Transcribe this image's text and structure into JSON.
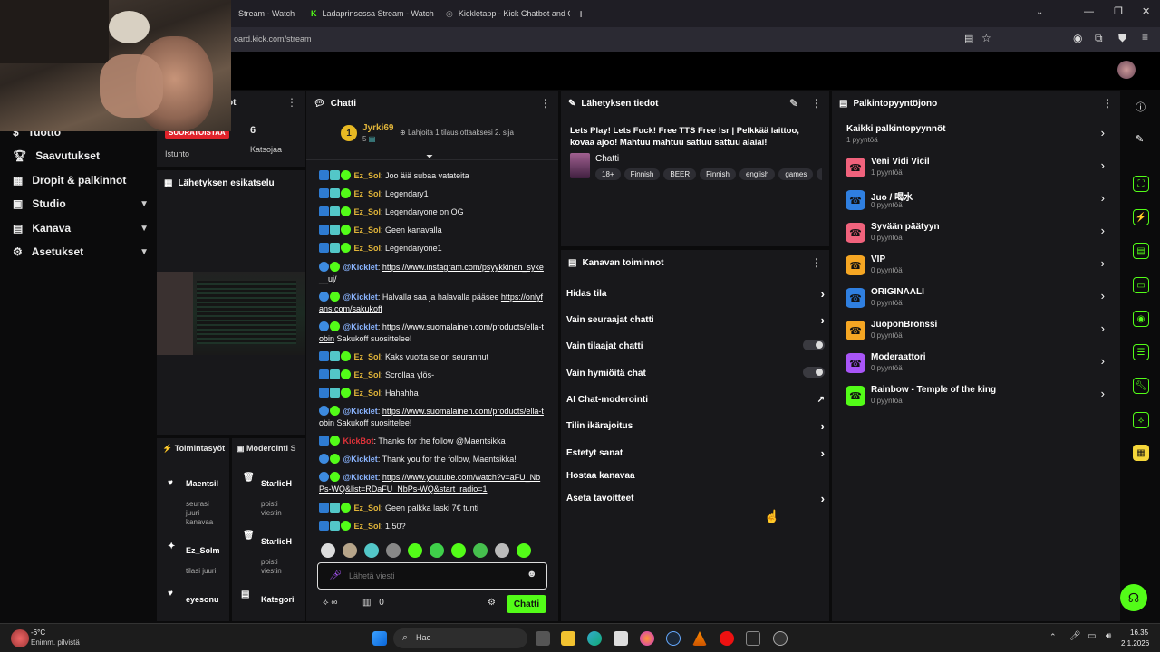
{
  "browser": {
    "tabs": [
      {
        "title": "Stream - Watch"
      },
      {
        "title": "Ladaprinsessa Stream - Watch L"
      },
      {
        "title": "Kickletapp - Kick Chatbot and C"
      }
    ],
    "new_tab": "+",
    "url": "oard.kick.com/stream"
  },
  "colors": {
    "accent": "#53fc18",
    "live_red": "#e1232b",
    "bot_blue": "#3d8be0"
  },
  "left_panel": {
    "live_badge": "SUORATOISTAA",
    "session_label": "Istunto",
    "viewers_count": "6",
    "viewers_label": "Katsojaa",
    "nav": [
      {
        "label": "Tuotto",
        "icon": "money-icon"
      },
      {
        "label": "Saavutukset",
        "icon": "trophy-icon"
      },
      {
        "label": "Dropit & palkinnot",
        "icon": "gift-icon"
      },
      {
        "label": "Studio",
        "icon": "studio-icon"
      },
      {
        "label": "Kanava",
        "icon": "channel-icon"
      },
      {
        "label": "Asetukset",
        "icon": "gear-icon"
      }
    ],
    "preview_title": "Lähetyksen esikatselu",
    "stats_title": "ot"
  },
  "activity": {
    "tab1": "Toimintasyöt",
    "tab2": "Moderointi",
    "tab3": "S",
    "items": [
      {
        "name": "Maentsil",
        "sub": [
          "seurasi",
          "juuri",
          "kanavaa"
        ]
      },
      {
        "name": "Ez_Solm",
        "sub": [
          "tilasi juuri"
        ]
      },
      {
        "name": "eyesonu",
        "sub": []
      }
    ],
    "mod_items": [
      {
        "name": "StarlieH",
        "sub": [
          "poisti",
          "viestin"
        ]
      },
      {
        "name": "StarlieH",
        "sub": [
          "poisti",
          "viestin"
        ]
      },
      {
        "name": "Kategori",
        "sub": []
      }
    ]
  },
  "chat": {
    "title": "Chatti",
    "pinned_user": "Jyrki69",
    "pinned_count": "5",
    "pinned_text": "Lahjoita 1 tilaus ottaaksesi 2. sija",
    "messages": [
      {
        "user": "Ez_Sol",
        "text": "Joo äiä subaa vatateita"
      },
      {
        "user": "Ez_Sol",
        "text": "Legendary1"
      },
      {
        "user": "Ez_Sol",
        "text": "Legendaryone on OG"
      },
      {
        "user": "Ez_Sol",
        "text": "Geen kanavalla"
      },
      {
        "user": "Ez_Sol",
        "text": "Legendaryone1"
      },
      {
        "user": "@Kicklet",
        "link": "https://www.instagram.com/psyykkinen_syke__uj/",
        "text": ""
      },
      {
        "user": "@Kicklet",
        "text": "Halvalla saa ja halavalla pääsee ",
        "link": "https://onlyfans.com/sakukoff"
      },
      {
        "user": "@Kicklet",
        "link": "https://www.suomalainen.com/products/ella-tobin",
        "text": " Sakukoff suosittelee!"
      },
      {
        "user": "Ez_Sol",
        "text": "Kaks vuotta se on seurannut"
      },
      {
        "user": "Ez_Sol",
        "text": "Scrollaa ylös-"
      },
      {
        "user": "Ez_Sol",
        "text": "Hahahha"
      },
      {
        "user": "@Kicklet",
        "link": "https://www.suomalainen.com/products/ella-tobin",
        "text": " Sakukoff suosittelee!"
      },
      {
        "user": "KickBot",
        "text": "Thanks for the follow @Maentsikka"
      },
      {
        "user": "@Kicklet",
        "text": "Thank you for the follow, Maentsikka!"
      },
      {
        "user": "@Kicklet",
        "link": "https://www.youtube.com/watch?v=aFU_NbPs-WQ&list=RDaFU_NbPs-WQ&start_radio=1",
        "text": ""
      },
      {
        "user": "Ez_Sol",
        "text": "Geen palkka laski 7€ tunti"
      },
      {
        "user": "Ez_Sol",
        "text": "1.50?"
      }
    ],
    "input_placeholder": "Lähetä viesti",
    "points": "0",
    "send_label": "Chatti"
  },
  "stream_info": {
    "title": "Lähetyksen tiedot",
    "stream_title": "Lets Play! Lets Fuck! Free TTS Free !sr | Pelkkää laittoo, kovaa ajoo! Mahtuu mahtuu sattuu sattuu alaiai!",
    "category": "Chatti",
    "tags": [
      "18+",
      "Finnish",
      "BEER",
      "Finnish",
      "english",
      "games",
      "ja"
    ]
  },
  "channel_functions": {
    "title": "Kanavan toiminnot",
    "rows": [
      {
        "label": "Hidas tila",
        "control": "chevron"
      },
      {
        "label": "Vain seuraajat chatti",
        "control": "chevron"
      },
      {
        "label": "Vain tilaajat chatti",
        "control": "toggle"
      },
      {
        "label": "Vain hymiöitä chat",
        "control": "toggle"
      },
      {
        "label": "AI Chat-moderointi",
        "control": "external"
      },
      {
        "label": "Tilin ikärajoitus",
        "control": "chevron"
      },
      {
        "label": "Estetyt sanat",
        "control": "chevron"
      },
      {
        "label": "Hostaa kanavaa",
        "control": "none"
      },
      {
        "label": "Aseta tavoitteet",
        "control": "chevron"
      }
    ]
  },
  "rewards": {
    "title": "Palkintopyyntöjono",
    "all_label": "Kaikki palkintopyynnöt",
    "all_count": "1 pyyntöä",
    "items": [
      {
        "name": "Veni Vidi Vicil",
        "count": "1 pyyntöä",
        "color": "#f0627c"
      },
      {
        "name": "Juo / 喝水",
        "count": "0 pyyntöä",
        "color": "#2f7fe0"
      },
      {
        "name": "Syvään päätyyn",
        "count": "0 pyyntöä",
        "color": "#f0627c"
      },
      {
        "name": "VIP",
        "count": "0 pyyntöä",
        "color": "#f5a623"
      },
      {
        "name": "ORIGINAALI",
        "count": "0 pyyntöä",
        "color": "#2f7fe0"
      },
      {
        "name": "JuoponBronssi",
        "count": "0 pyyntöä",
        "color": "#f5a623"
      },
      {
        "name": "Moderaattori",
        "count": "0 pyyntöä",
        "color": "#a855f7"
      },
      {
        "name": "Rainbow - Temple of the king",
        "count": "0 pyyntöä",
        "color": "#53fc18"
      }
    ]
  },
  "taskbar": {
    "weather_temp": "-6°C",
    "weather_desc": "Enimm. pilvistä",
    "search_label": "Hae",
    "time": "16.35",
    "date": "2.1.2026"
  }
}
